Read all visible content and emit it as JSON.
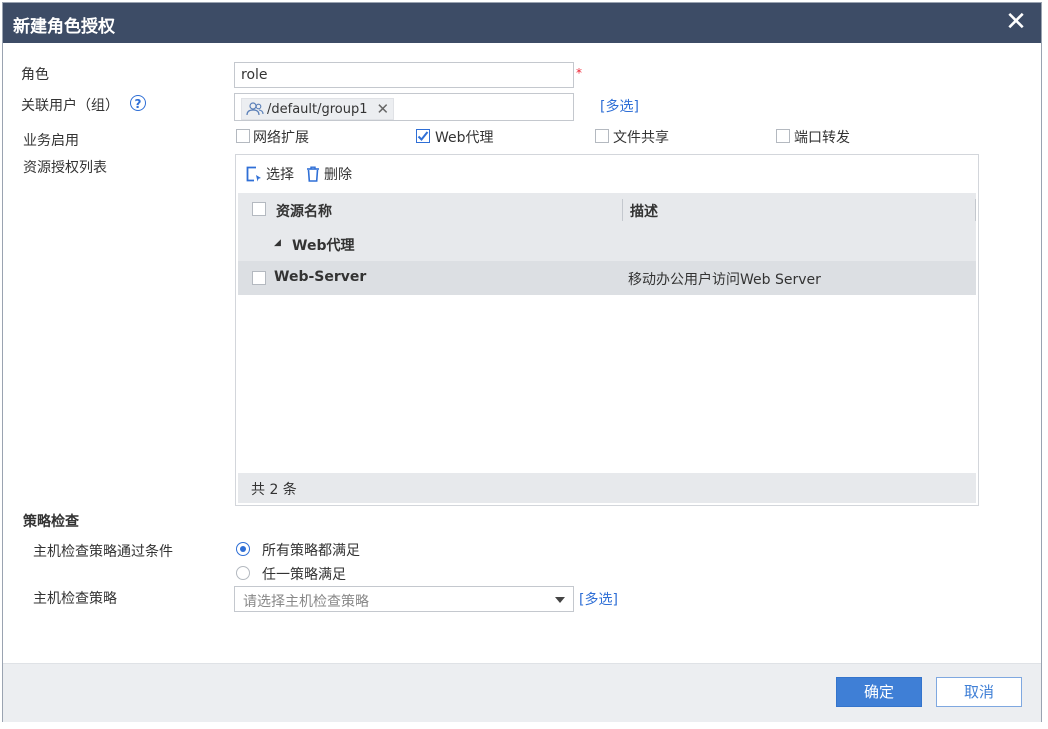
{
  "dialog": {
    "title": "新建角色授权",
    "close_label": "✕"
  },
  "form": {
    "role_label": "角色",
    "role_value": "role",
    "required_mark": "*",
    "users_label": "关联用户（组）",
    "help_label": "?",
    "users_tag": "/default/group1",
    "tag_remove": "✕",
    "multi_select": "[多选]",
    "service_label": "业务启用",
    "services": [
      {
        "label": "网络扩展",
        "checked": false
      },
      {
        "label": "Web代理",
        "checked": true
      },
      {
        "label": "文件共享",
        "checked": false
      },
      {
        "label": "端口转发",
        "checked": false
      }
    ],
    "resource_list_label": "资源授权列表"
  },
  "resource_table": {
    "select_btn": "选择",
    "delete_btn": "删除",
    "columns": [
      "资源名称",
      "描述"
    ],
    "group_name": "Web代理",
    "rows": [
      {
        "name": "Web-Server",
        "description": "移动办公用户访问Web Server"
      }
    ],
    "total_text": "共 2 条"
  },
  "policy": {
    "section_title": "策略检查",
    "condition_label": "主机检查策略通过条件",
    "options": [
      "所有策略都满足",
      "任一策略满足"
    ],
    "selected_option": 0,
    "policy_label": "主机检查策略",
    "policy_placeholder": "请选择主机检查策略",
    "multi_select": "[多选]"
  },
  "footer": {
    "ok_label": "确定",
    "cancel_label": "取消"
  },
  "colors": {
    "title_bar": "#3d4c66",
    "accent": "#3f7fd6",
    "required": "#e22233"
  }
}
